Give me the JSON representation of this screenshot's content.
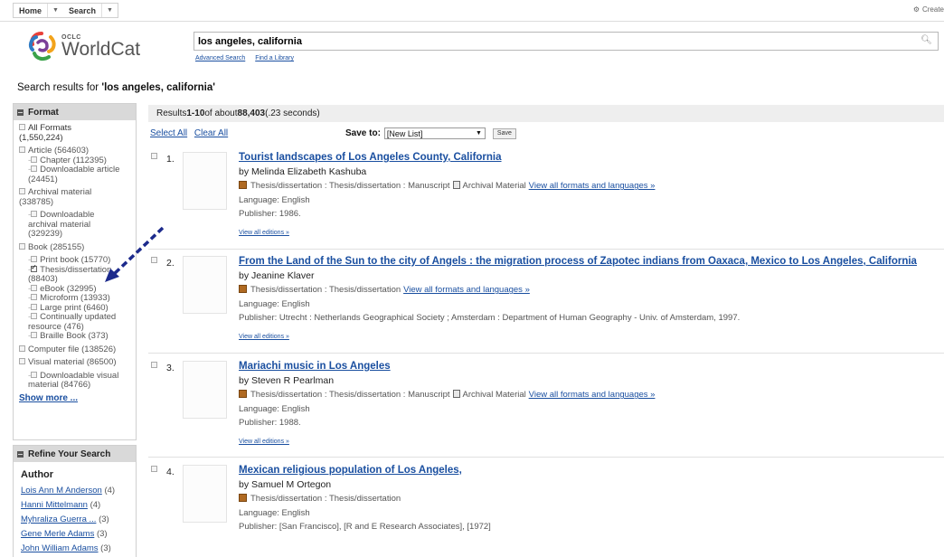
{
  "nav": {
    "home": "Home",
    "search": "Search",
    "create": "Create"
  },
  "logo": {
    "oclc": "OCLC",
    "name": "WorldCat"
  },
  "search": {
    "query": "los angeles, california",
    "advanced": "Advanced Search",
    "library": "Find a Library"
  },
  "results_heading": {
    "prefix": "Search results for ",
    "query": "'los angeles, california'"
  },
  "format_panel": {
    "title": "Format",
    "all_formats": "All Formats",
    "all_count": "(1,550,224)",
    "article": "Article (564603)",
    "chapter": "Chapter (112395)",
    "downloadable_article": "Downloadable article",
    "downloadable_article_count": "(24451)",
    "archival": "Archival material",
    "archival_count": "(338785)",
    "downloadable_archival": "Downloadable",
    "downloadable_archival_2": "archival material",
    "downloadable_archival_count": "(329239)",
    "book": "Book (285155)",
    "print_book": "Print book (15770)",
    "thesis": "Thesis/dissertation",
    "thesis_count": "(88403)",
    "ebook": "eBook (32995)",
    "microform": "Microform (13933)",
    "large_print": "Large print (6460)",
    "continually": "Continually updated",
    "continually_2": "resource (476)",
    "braille": "Braille Book (373)",
    "computer": "Computer file (138526)",
    "visual": "Visual material (86500)",
    "downloadable_visual": "Downloadable visual",
    "downloadable_visual_count": "material (84766)",
    "show_more": "Show more ..."
  },
  "refine_panel": {
    "title": "Refine Your Search",
    "author_heading": "Author",
    "authors": [
      {
        "name": "Lois Ann M Anderson",
        "count": "(4)"
      },
      {
        "name": "Hanni Mittelmann",
        "count": "(4)"
      },
      {
        "name": "Myhraliza Guerra ...",
        "count": "(3)"
      },
      {
        "name": "Gene Merle Adams",
        "count": "(3)"
      },
      {
        "name": "John William Adams",
        "count": "(3)"
      }
    ]
  },
  "results_bar": {
    "prefix": "Results ",
    "range": "1-10",
    "mid": " of about ",
    "total": "88,403",
    "suffix": " (.23 seconds)"
  },
  "toolbar": {
    "select_all": "Select All",
    "clear_all": "Clear All",
    "save_to": "Save to:",
    "list": "[New List]",
    "save": "Save"
  },
  "results": [
    {
      "num": "1.",
      "title": "Tourist landscapes of Los Angeles County, California",
      "author": "by Melinda Elizabeth Kashuba",
      "format": "Thesis/dissertation : Thesis/dissertation : Manuscript",
      "archival": "Archival Material",
      "view_formats": "View all formats and languages »",
      "language": "Language: English",
      "publisher": "Publisher: 1986.",
      "editions": "View all editions »"
    },
    {
      "num": "2.",
      "title": "From the Land of the Sun to the city of Angels : the migration process of Zapotec indians from Oaxaca, Mexico to Los Angeles, California",
      "author": "by Jeanine Klaver",
      "format": "Thesis/dissertation : Thesis/dissertation",
      "archival": "",
      "view_formats": "View all formats and languages »",
      "language": "Language: English",
      "publisher": "Publisher: Utrecht : Netherlands Geographical Society ; Amsterdam : Department of Human Geography - Univ. of Amsterdam, 1997.",
      "editions": "View all editions »"
    },
    {
      "num": "3.",
      "title": "Mariachi music in Los Angeles",
      "author": "by Steven R Pearlman",
      "format": "Thesis/dissertation : Thesis/dissertation : Manuscript",
      "archival": "Archival Material",
      "view_formats": "View all formats and languages »",
      "language": "Language: English",
      "publisher": "Publisher: 1988.",
      "editions": "View all editions »"
    },
    {
      "num": "4.",
      "title": "Mexican religious population of Los Angeles,",
      "author": "by Samuel M Ortegon",
      "format": "Thesis/dissertation : Thesis/dissertation",
      "archival": "",
      "view_formats": "",
      "language": "Language: English",
      "publisher": "Publisher: [San Francisco], [R and E Research Associates], [1972]",
      "editions": ""
    }
  ],
  "colors": {
    "link": "#1a4fa0",
    "panel_header": "#d9d9d9",
    "arrow": "#1c2a8c"
  }
}
